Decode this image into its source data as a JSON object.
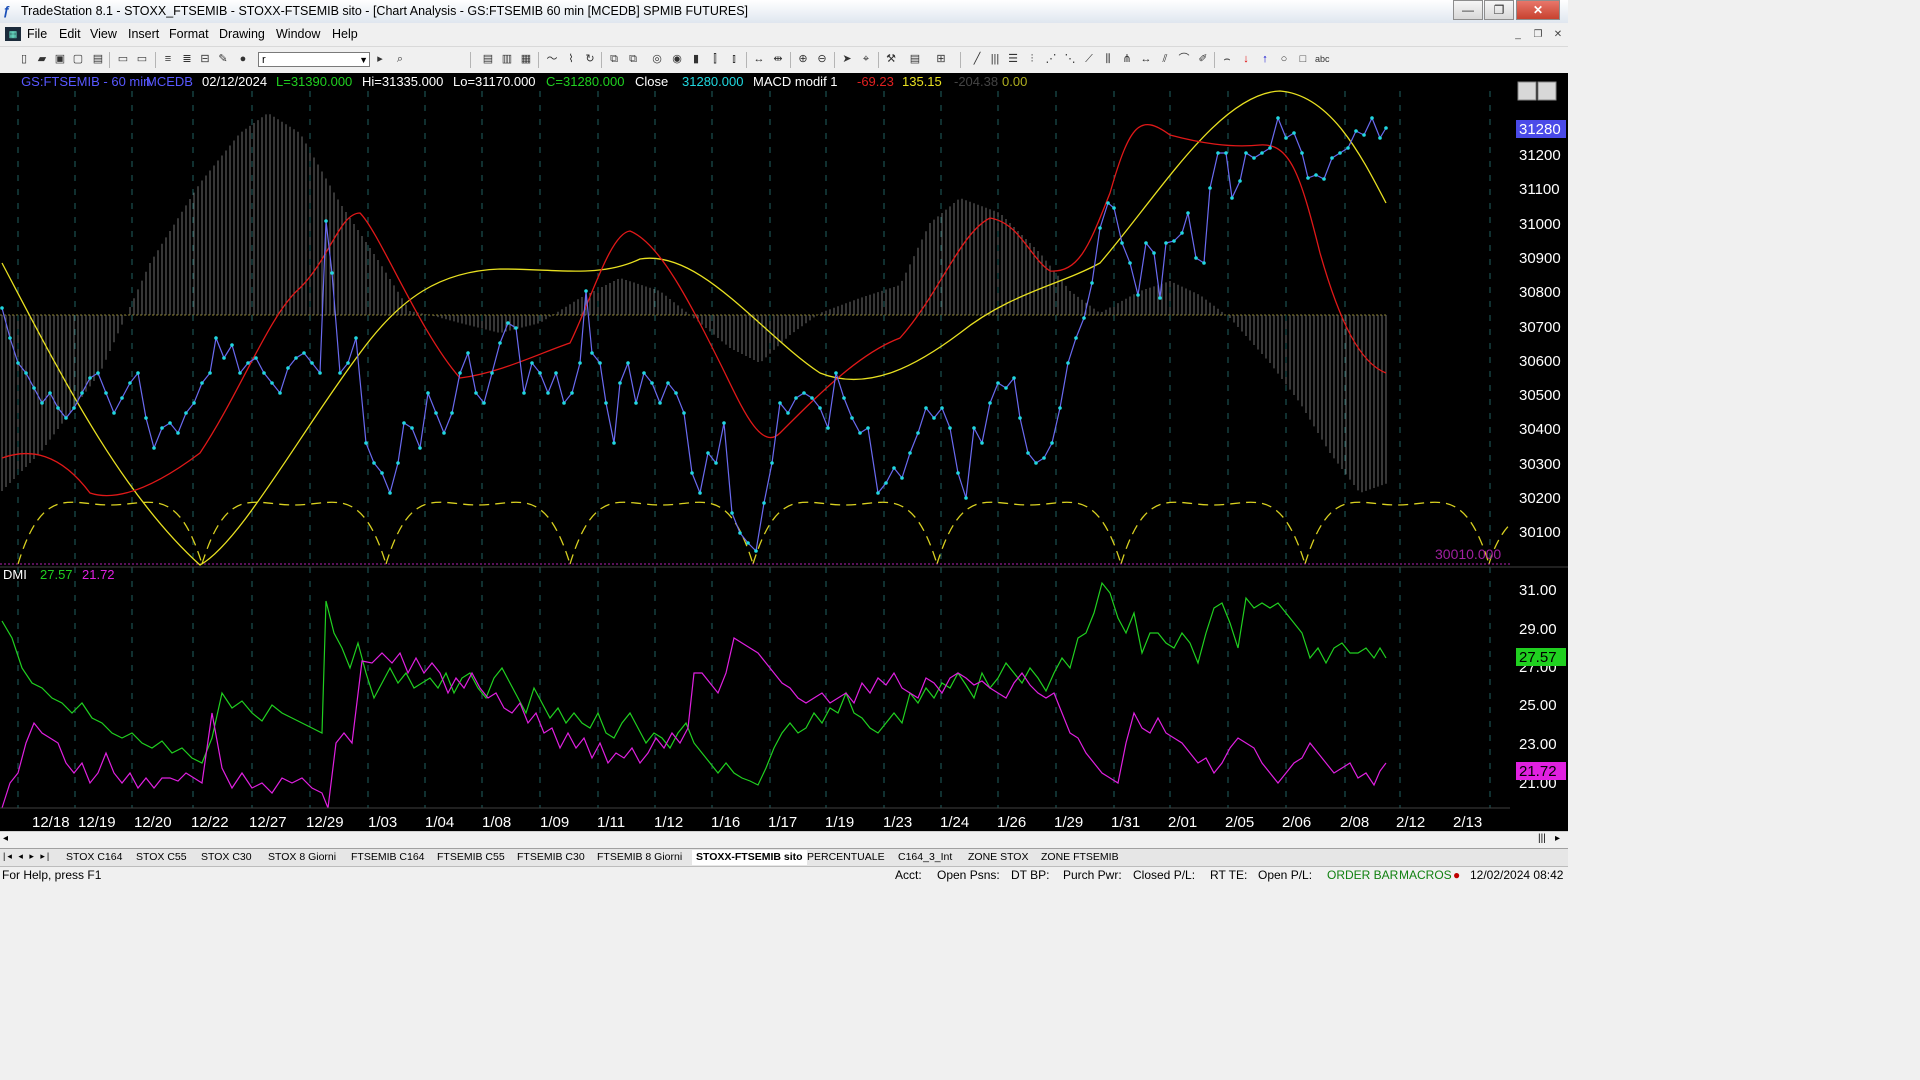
{
  "window": {
    "title": "TradeStation 8.1 - STOXX_FTSEMIB - STOXX-FTSEMIB sito - [Chart Analysis - GS:FTSEMIB  60 min  [MCEDB] SPMIB FUTURES]",
    "minimize": "—",
    "restore": "❐",
    "close": "✕"
  },
  "menu": {
    "items": [
      "File",
      "Edit",
      "View",
      "Insert",
      "Format",
      "Drawing",
      "Window",
      "Help"
    ]
  },
  "toolbar": {
    "symbol_value": "r"
  },
  "chart": {
    "header": {
      "symbol": "GS:FTSEMIB - 60 min",
      "bar_type": "MCEDB",
      "date": "02/12/2024",
      "last": "L=31390.000",
      "high": "Hi=31335.000",
      "low": "Lo=31170.000",
      "close_eq": "C=31280.000",
      "close_label": "Close",
      "close_value": "31280.000",
      "indicator": "MACD modif 1",
      "v1": "-69.23",
      "v2": "135.15",
      "v3": "-204.38",
      "v4": "0.00"
    },
    "price_axis": [
      "31200",
      "31100",
      "31000",
      "30900",
      "30800",
      "30700",
      "30600",
      "30500",
      "30400",
      "30300",
      "30200",
      "30100"
    ],
    "last_price_label": "31280",
    "bottom_value": "30010.000",
    "dmi": {
      "label": "DMI",
      "plus": "27.57",
      "minus": "21.72"
    },
    "dmi_axis": [
      "31.00",
      "29.00",
      "27.00",
      "25.00",
      "23.00",
      "21.00"
    ],
    "dates": [
      "12/18",
      "12/19",
      "12/20",
      "12/22",
      "12/27",
      "12/29",
      "1/03",
      "1/04",
      "1/08",
      "1/09",
      "1/11",
      "1/12",
      "1/16",
      "1/17",
      "1/19",
      "1/23",
      "1/24",
      "1/26",
      "1/29",
      "1/31",
      "2/01",
      "2/05",
      "2/06",
      "2/08",
      "2/12",
      "2/13"
    ],
    "colors": {
      "background": "#000000",
      "price": "#6a6af0",
      "price_dots": "#20d8e0",
      "red_line": "#e01818",
      "yellow_line": "#e8e020",
      "cycles": "#d8d020",
      "histogram": "#7a7a7a",
      "dmi_plus": "#20d020",
      "dmi_minus": "#e020e0"
    }
  },
  "sheets": {
    "tabs": [
      "STOX C164",
      "STOX C55",
      "STOX  C30",
      "STOX  8 Giorni",
      "FTSEMIB C164",
      "FTSEMIB C55",
      "FTSEMIB C30",
      "FTSEMIB  8 Giorni",
      "STOXX-FTSEMIB sito",
      "PERCENTUALE",
      "C164_3_Int",
      "ZONE STOX",
      "ZONE FTSEMIB"
    ],
    "active": "STOXX-FTSEMIB sito"
  },
  "status": {
    "help": "For Help, press F1",
    "acct": "Acct:",
    "open_psns": "Open Psns:",
    "dt_bp": "DT BP:",
    "purch_pwr": "Purch Pwr:",
    "closed_pl": "Closed P/L:",
    "rt_te": "RT TE:",
    "open_pl": "Open P/L:",
    "order_bar": "ORDER BAR",
    "macros": "MACROS",
    "datetime": "12/02/2024 08:42"
  }
}
